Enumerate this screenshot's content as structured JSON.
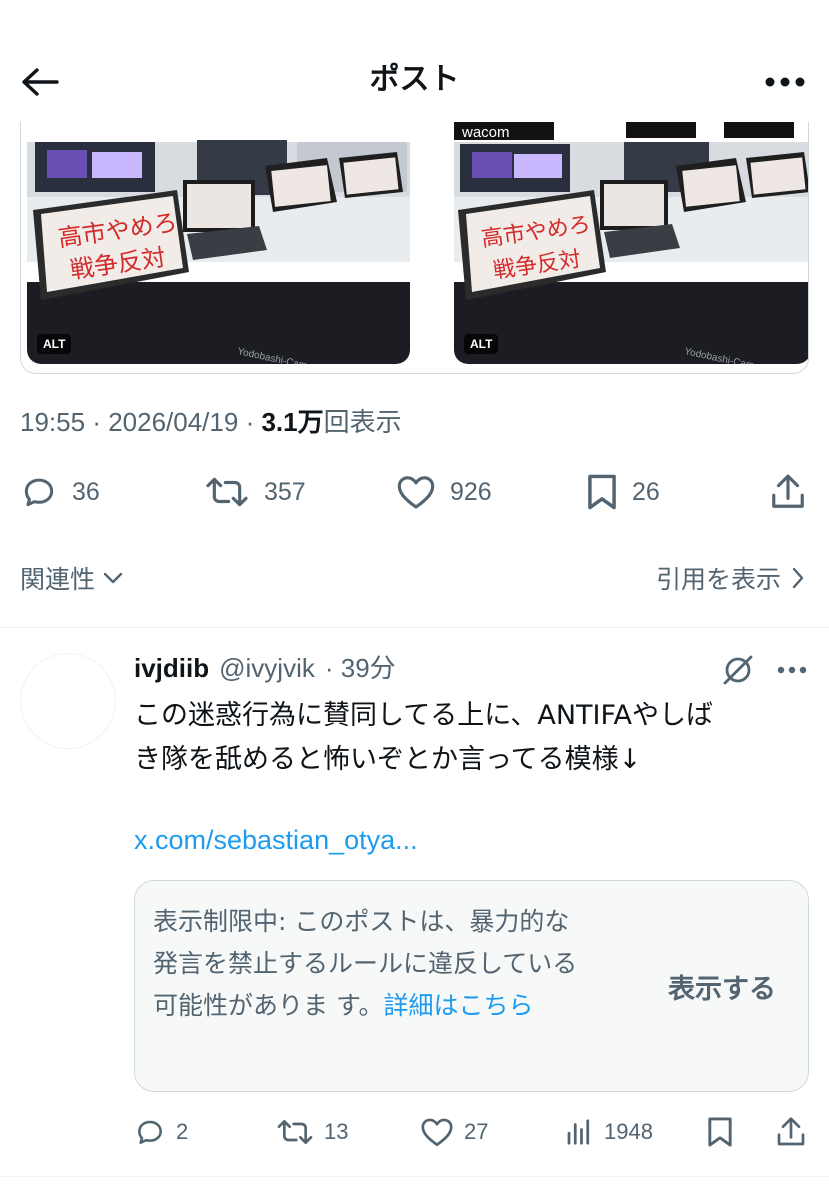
{
  "header": {
    "title": "ポスト"
  },
  "media": [
    {
      "alt_badge": "ALT",
      "sign_line1": "高市やめろ",
      "sign_line2": "戦争反対",
      "brand": ""
    },
    {
      "alt_badge": "ALT",
      "sign_line1": "高市やめろ",
      "sign_line2": "戦争反対",
      "brand": "wacom"
    }
  ],
  "meta": {
    "time": "19:55",
    "date": "2026/04/19",
    "views": "3.1万",
    "views_label": "回表示"
  },
  "actions": {
    "replies": "36",
    "reposts": "357",
    "likes": "926",
    "bookmarks": "26"
  },
  "relevance": {
    "label": "関連性"
  },
  "quotes": {
    "label": "引用を表示"
  },
  "reply": {
    "name": "ivjdiib",
    "handle": "@ivyjvik",
    "time": "· 39分",
    "text": "この迷惑行為に賛同してる上に、ANTIFAやしば\nき隊を舐めると怖いぞとか言ってる模様↓",
    "link": "x.com/sebastian_otya...",
    "warning": {
      "text": "表示制限中: このポストは、暴力的な発言を禁止するルールに違反している可能性がありま す。",
      "detail": "詳細はこちら",
      "show": "表示する"
    },
    "actions": {
      "replies": "2",
      "reposts": "13",
      "likes": "27",
      "views": "1948"
    }
  },
  "colors": {
    "accent": "#1d9bf0",
    "secondary": "#536471",
    "primary": "#0f1419"
  },
  "icons": [
    "back-arrow-icon",
    "more-icon",
    "reply-icon",
    "repost-icon",
    "like-icon",
    "bookmark-icon",
    "share-icon",
    "chevron-down-icon",
    "chevron-right-icon",
    "grok-icon",
    "views-icon"
  ]
}
